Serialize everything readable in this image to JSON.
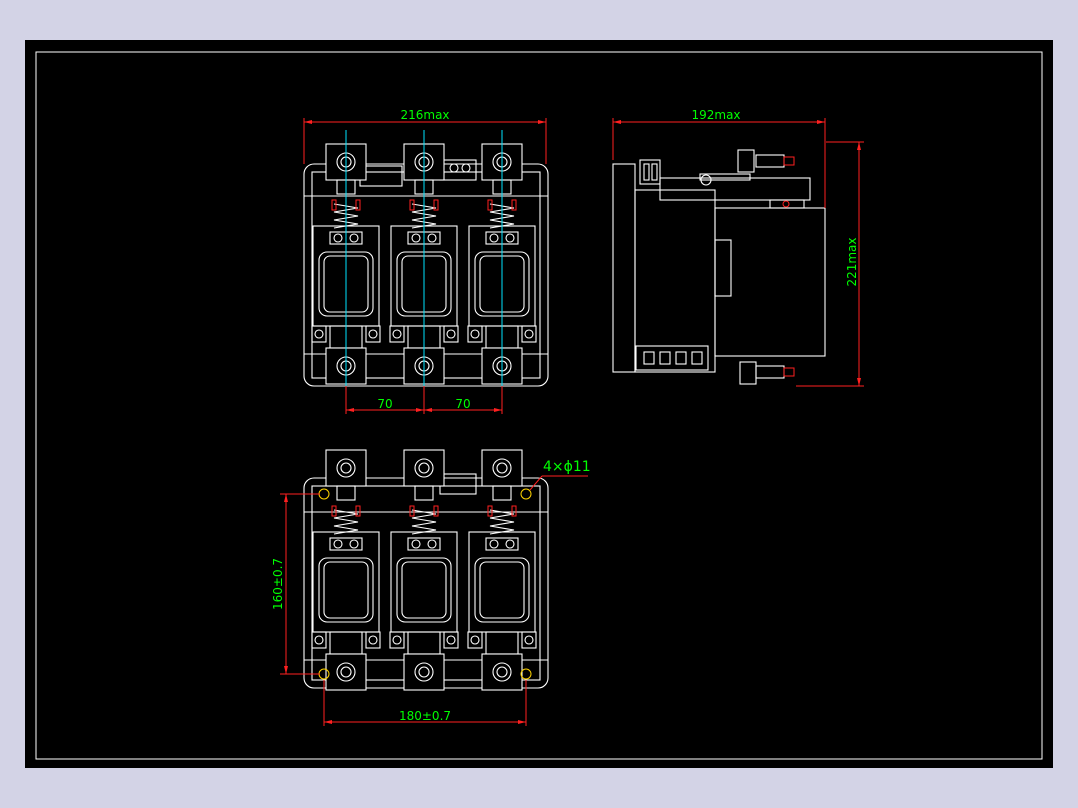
{
  "front_view": {
    "width_label": "216max",
    "pitch_left_label": "70",
    "pitch_right_label": "70"
  },
  "side_view": {
    "depth_label": "192max",
    "height_label": "221max"
  },
  "bottom_view": {
    "holes_label": "4×ϕ11",
    "height_label": "160±0.7",
    "width_label": "180±0.7"
  },
  "colors": {
    "background": "#d3d3e6",
    "sheet": "#000000",
    "outline": "#ffffff",
    "dimension_line": "#ff2020",
    "dimension_text": "#00ff00",
    "centerline": "#00e5ff"
  }
}
